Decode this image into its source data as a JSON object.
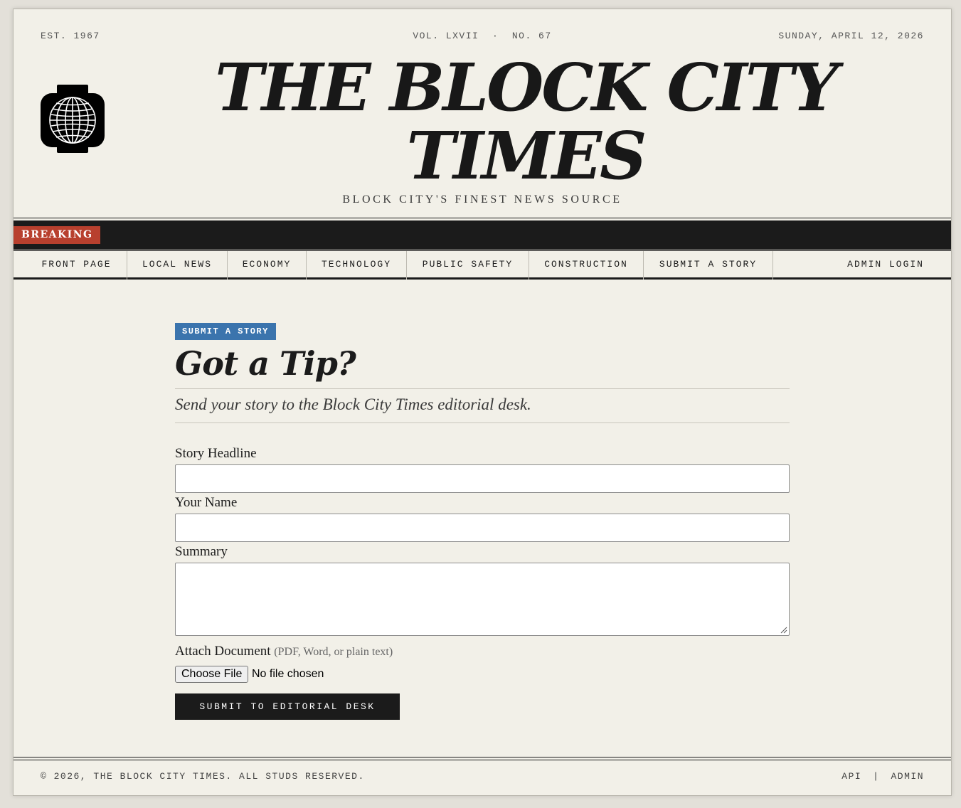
{
  "masthead": {
    "established": "EST. 1967",
    "volume": "VOL. LXVII  ·  NO. 67",
    "date": "SUNDAY, APRIL 12, 2026",
    "title": "THE BLOCK CITY TIMES",
    "tagline": "BLOCK CITY'S FINEST NEWS SOURCE",
    "logo_icon": "lego-head-globe-icon"
  },
  "breaking": {
    "label": "BREAKING",
    "color": "#b8402e"
  },
  "nav": {
    "items": [
      {
        "label": "FRONT PAGE"
      },
      {
        "label": "LOCAL NEWS"
      },
      {
        "label": "ECONOMY"
      },
      {
        "label": "TECHNOLOGY"
      },
      {
        "label": "PUBLIC SAFETY"
      },
      {
        "label": "CONSTRUCTION"
      },
      {
        "label": "SUBMIT A STORY"
      }
    ],
    "admin": "ADMIN LOGIN"
  },
  "main": {
    "kicker": "SUBMIT A STORY",
    "kicker_color": "#3b74ad",
    "headline": "Got a Tip?",
    "dek": "Send your story to the Block City Times editorial desk.",
    "form": {
      "headline_label": "Story Headline",
      "headline_value": "",
      "name_label": "Your Name",
      "name_value": "",
      "summary_label": "Summary",
      "summary_value": "",
      "attach_label": "Attach Document",
      "attach_hint": "(PDF, Word, or plain text)",
      "choose_file": "Choose File",
      "no_file": "No file chosen",
      "submit": "SUBMIT TO EDITORIAL DESK"
    }
  },
  "footer": {
    "copyright": "© 2026, THE BLOCK CITY TIMES. ALL STUDS RESERVED.",
    "api": "API",
    "separator": "|",
    "admin": "ADMIN"
  }
}
